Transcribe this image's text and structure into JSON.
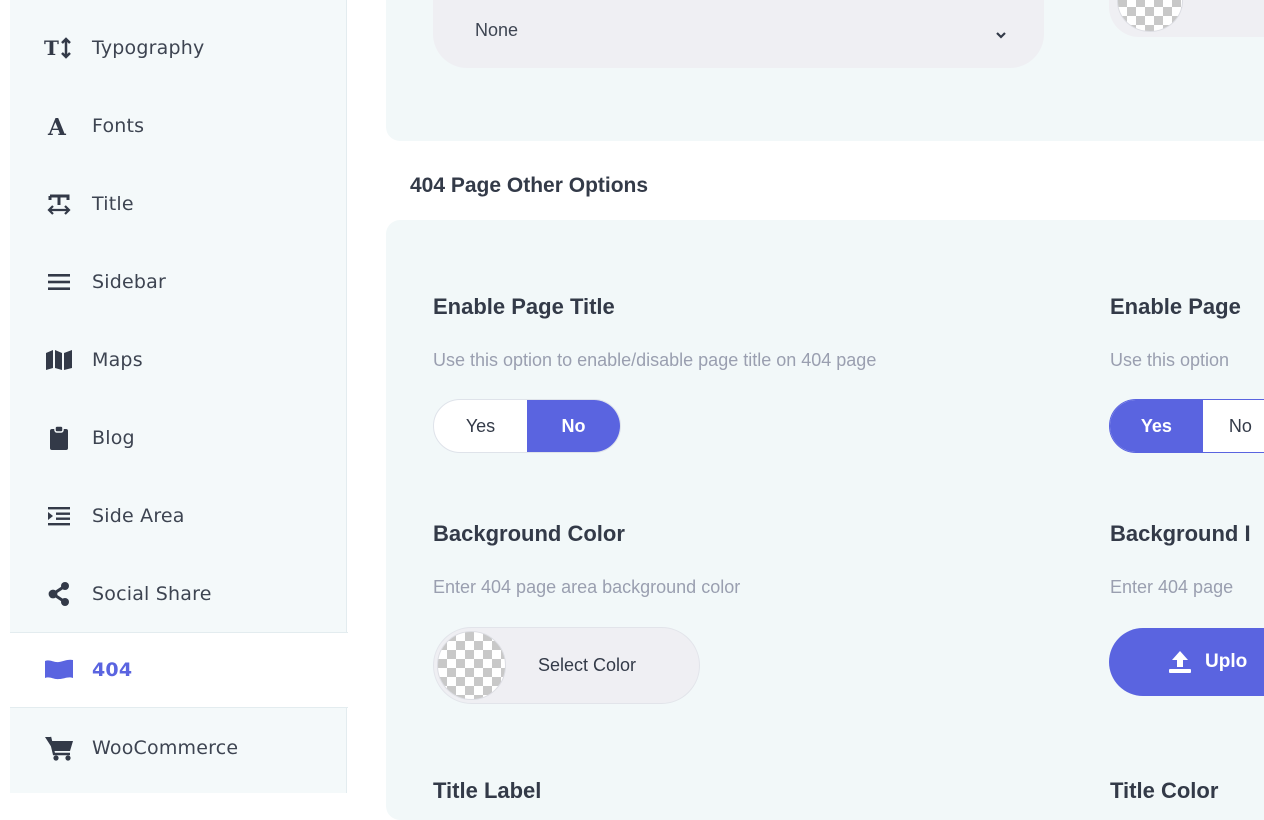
{
  "sidebar": {
    "items": [
      {
        "label": "Typography",
        "icon": "text-height-icon"
      },
      {
        "label": "Fonts",
        "icon": "font-icon"
      },
      {
        "label": "Title",
        "icon": "text-width-icon"
      },
      {
        "label": "Sidebar",
        "icon": "bars-icon"
      },
      {
        "label": "Maps",
        "icon": "map-icon"
      },
      {
        "label": "Blog",
        "icon": "clipboard-icon"
      },
      {
        "label": "Side Area",
        "icon": "indent-icon"
      },
      {
        "label": "Social Share",
        "icon": "share-icon"
      },
      {
        "label": "404",
        "icon": "flag-icon",
        "active": true
      },
      {
        "label": "WooCommerce",
        "icon": "cart-icon"
      }
    ],
    "active_color": "#5a64e0"
  },
  "top": {
    "select_value": "None"
  },
  "section": {
    "title": "404 Page Other Options"
  },
  "options": {
    "page_title": {
      "title": "Enable Page Title",
      "desc": "Use this option to enable/disable page title on 404 page",
      "yes": "Yes",
      "no": "No",
      "selected": "No"
    },
    "page_title_right": {
      "title": "Enable Page",
      "desc": "Use this option",
      "yes": "Yes",
      "no": "No",
      "selected": "Yes"
    },
    "bg_color": {
      "title": "Background Color",
      "desc": "Enter 404 page area background color",
      "button": "Select Color"
    },
    "bg_image": {
      "title": "Background I",
      "desc": "Enter 404 page",
      "button": "Uplo"
    },
    "title_label": {
      "title": "Title Label"
    },
    "title_color": {
      "title": "Title Color"
    }
  },
  "colors": {
    "accent": "#5a64e0",
    "card_bg": "#f2f8f9"
  }
}
